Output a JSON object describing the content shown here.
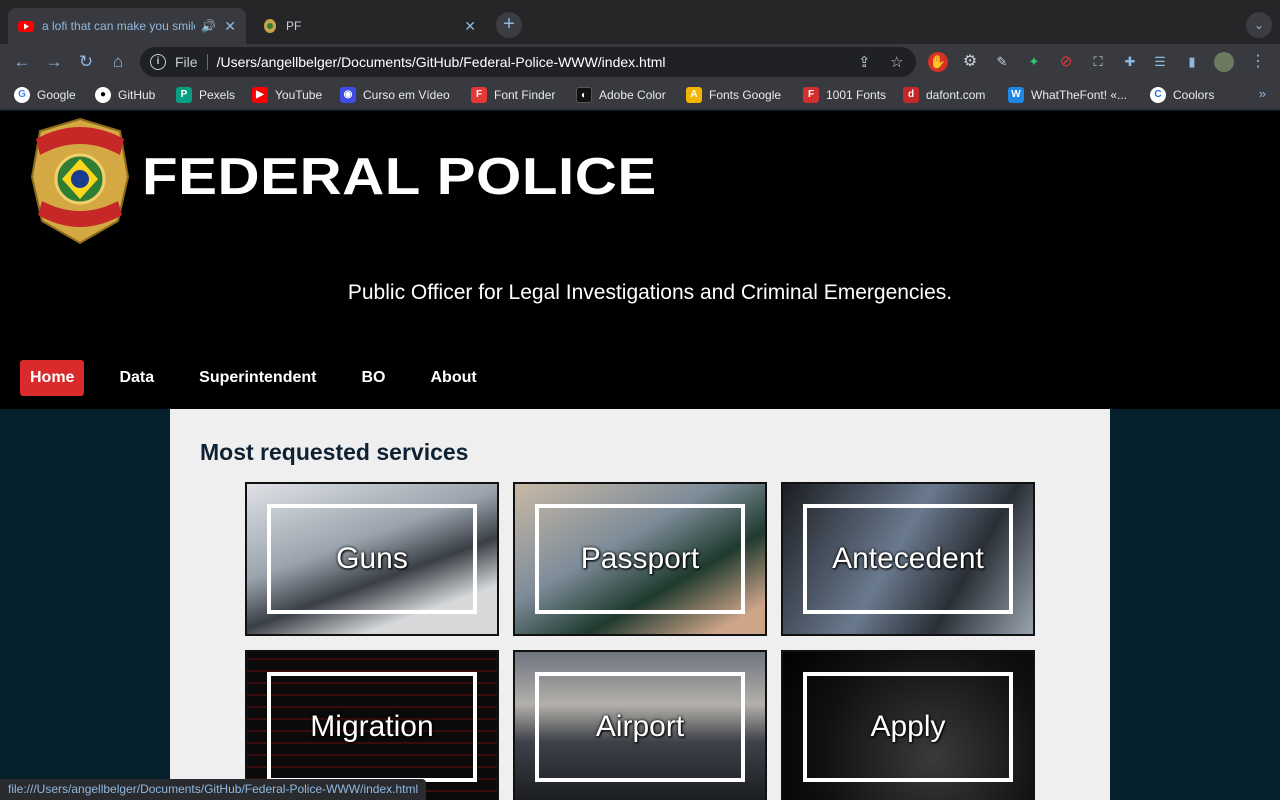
{
  "browser": {
    "tabs": [
      {
        "title": "a lofi that can make you smile",
        "active": true
      },
      {
        "title": "PF",
        "active": false
      }
    ],
    "address": {
      "scheme": "File",
      "url": "/Users/angellbelger/Documents/GitHub/Federal-Police-WWW/index.html"
    },
    "bookmarks": [
      "Google",
      "GitHub",
      "Pexels",
      "YouTube",
      "Curso em Vídeo",
      "Font Finder",
      "Adobe Color",
      "Fonts Google",
      "1001 Fonts",
      "dafont.com",
      "WhatTheFont! «...",
      "Coolors"
    ],
    "status_url": "file:///Users/angellbelger/Documents/GitHub/Federal-Police-WWW/index.html"
  },
  "site": {
    "badge_text_top": "POLÍCIA",
    "badge_text_bottom": "FEDERAL",
    "brand": "FEDERAL POLICE",
    "tagline": "Public Officer for Legal Investigations and Criminal Emergencies.",
    "nav": [
      "Home",
      "Data",
      "Superintendent",
      "BO",
      "About"
    ],
    "active_nav": "Home",
    "section_title": "Most requested services",
    "services": [
      "Guns",
      "Passport",
      "Antecedent",
      "Migration",
      "Airport",
      "Apply"
    ],
    "accent_color": "#d92b2b"
  }
}
